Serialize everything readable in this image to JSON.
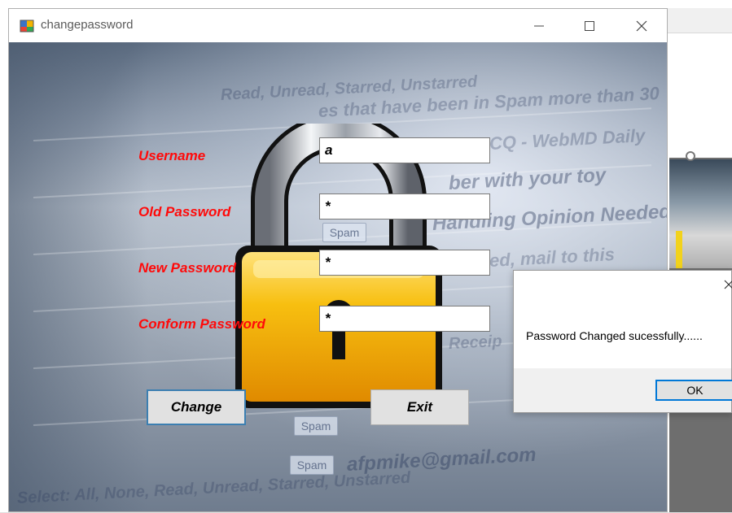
{
  "window": {
    "title": "changepassword",
    "icon": "winforms-app-icon",
    "controls": {
      "minimize": "minimize-icon",
      "maximize": "maximize-icon",
      "close": "close-icon"
    }
  },
  "form": {
    "username_label": "Username",
    "username_value": "a",
    "old_password_label": "Old Password",
    "old_password_value": "*",
    "new_password_label": "New Password",
    "new_password_value": "*",
    "confirm_password_label": "Conform Password",
    "confirm_password_value": "*",
    "change_button": "Change",
    "exit_button": "Exit"
  },
  "background_image_text": {
    "line1": "Read, Unread, Starred, Unstarred",
    "line2": "es that have been in Spam more than 30",
    "line3": "CQ - WebMD Daily",
    "line4": "ber with your toy",
    "line5": "Handling Opinion Needed",
    "line6": "ed, mail to this",
    "line7": "Receip",
    "line8": "afpmike@gmail.com",
    "line9": "Select: All, None, Read, Unread, Starred, Unstarred",
    "spam_tag": "Spam",
    "lock_icon": "padlock-icon"
  },
  "message_box": {
    "text": "Password Changed sucessfully......",
    "ok_button": "OK",
    "close": "close-icon"
  },
  "colors": {
    "label_red": "#ff0a0a",
    "accent_blue": "#0078d7",
    "lock_yellow": "#f5b800"
  }
}
